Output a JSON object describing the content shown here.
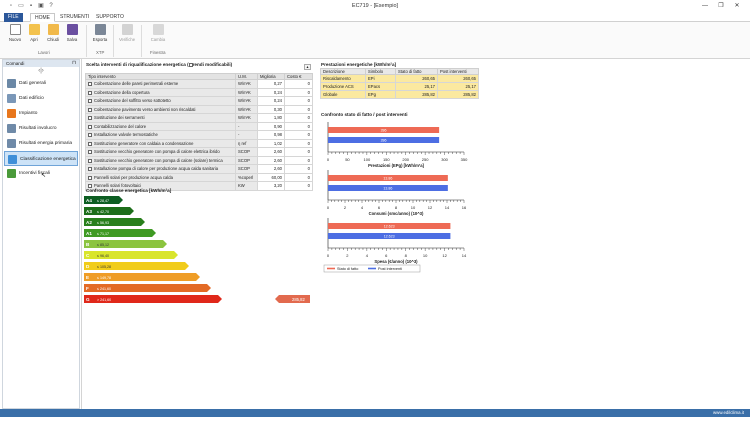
{
  "window": {
    "title": "EC719 - [Esempio]",
    "min": "—",
    "max": "❐",
    "close": "✕"
  },
  "menu": {
    "file": "FILE",
    "home": "HOME",
    "tools": "STRUMENTI",
    "support": "SUPPORTO"
  },
  "ribbon": {
    "new": "Nuovo",
    "open": "Apri",
    "close": "Chiudi",
    "save": "Salva",
    "export": "Esporta",
    "verify": "Verifiche",
    "change": "Cambia",
    "group_work": "Lavori",
    "group_xtp": "XTP",
    "group_window": "Finestra"
  },
  "sidebar": {
    "header": "Comandi",
    "items": [
      {
        "label": "Dati generali",
        "icon": "general-data-icon",
        "color": "#6b88a6"
      },
      {
        "label": "Dati edificio",
        "icon": "building-data-icon",
        "color": "#7a97b8"
      },
      {
        "label": "Impianto",
        "icon": "flame-icon",
        "color": "#e8761c"
      },
      {
        "label": "Risultati involucro",
        "icon": "grid-icon",
        "color": "#6f8aa8"
      },
      {
        "label": "Risultati energia primaria",
        "icon": "grid-icon",
        "color": "#6f8aa8"
      },
      {
        "label": "Classificazione energetica",
        "icon": "energy-class-icon",
        "color": "#3f8fd8"
      },
      {
        "label": "Incentivi fiscali",
        "icon": "leaf-icon",
        "color": "#4a9a3a"
      }
    ]
  },
  "interventions": {
    "title": "Scelta interventi di riqualificazione energetica (",
    "title_suffix": "rendi modificabili)",
    "headers": [
      "Tipo intervento",
      "U.M.",
      "Miglioria",
      "Costo €"
    ],
    "rows": [
      [
        "Coibentazione delle pareti perimetrali esterne",
        "W/m²K",
        "0,27",
        "0"
      ],
      [
        "Coibentazione della copertura",
        "W/m²K",
        "0,24",
        "0"
      ],
      [
        "Coibentazione del soffitto verso sottotetto",
        "W/m²K",
        "0,24",
        "0"
      ],
      [
        "Coibentazione pavimento verso ambienti non riscaldati",
        "W/m²K",
        "0,30",
        "0"
      ],
      [
        "Sostituzione dei serramenti",
        "W/m²K",
        "1,80",
        "0"
      ],
      [
        "Contabilizzazione del calore",
        "-",
        "0,90",
        "0"
      ],
      [
        "Installazione valvole termostatiche",
        "-",
        "0,98",
        "0"
      ],
      [
        "Sostituzione generatore con caldaia a condensazione",
        "η ref",
        "1,02",
        "0"
      ],
      [
        "Sostituzione vecchio generatore con pompa di calore elettrica ibrido",
        "SCOP",
        "2,60",
        "0"
      ],
      [
        "Sostituzione vecchio generatore con pompa di calore (solare) termica",
        "SCOP",
        "2,60",
        "0"
      ],
      [
        "Installazione pompa di calore per produzione acqua calda sanitaria",
        "SCOP",
        "2,60",
        "0"
      ],
      [
        "Pannelli solari per produzione acqua calda",
        "%coperl",
        "60,00",
        "0"
      ],
      [
        "Pannelli solari fotovoltaici",
        "KW",
        "3,20",
        "0"
      ]
    ]
  },
  "classes": {
    "title": "Confronto classe energetica [kWh/m²a]",
    "list": [
      {
        "label": "A4",
        "value": "≤ 28,47",
        "color": "#0d5e22"
      },
      {
        "label": "A3",
        "value": "≤ 42,70",
        "color": "#1d6e1a"
      },
      {
        "label": "A2",
        "value": "≤ 56,93",
        "color": "#297f1c"
      },
      {
        "label": "A1",
        "value": "≤ 71,17",
        "color": "#3f9a23"
      },
      {
        "label": "B",
        "value": "≤ 85,12",
        "color": "#8bc43f"
      },
      {
        "label": "C",
        "value": "≤ 96,40",
        "color": "#d9e52c"
      },
      {
        "label": "D",
        "value": "≤ 105,28",
        "color": "#f1cc1a"
      },
      {
        "label": "E",
        "value": "≤ 149,78",
        "color": "#ef9d26"
      },
      {
        "label": "F",
        "value": "≤ 241,60",
        "color": "#e36a25"
      },
      {
        "label": "G",
        "value": "> 241,60",
        "color": "#e0281a"
      }
    ],
    "marker_value": "285,82",
    "marker_color": "#e26a4e"
  },
  "performance": {
    "title": "Prestazioni energetiche [kWh/m²a]",
    "headers": [
      "Descrizione",
      "Simbolo",
      "Stato di fatto",
      "Post interventi"
    ],
    "rows": [
      [
        "Riscaldamento",
        "EPi",
        "260,65",
        "260,65"
      ],
      [
        "Produzione ACS",
        "EPacs",
        "25,17",
        "25,17"
      ],
      [
        "Globale",
        "EPg",
        "285,82",
        "285,82"
      ]
    ]
  },
  "compare_title": "Confronto stato di fatto / post interventi",
  "chart_data": {
    "type": "bar",
    "charts": [
      {
        "title": "Prestazioni (EPg) [kWh/m²a]",
        "xlim": [
          0,
          350
        ],
        "ticks": [
          0,
          50,
          100,
          150,
          200,
          250,
          300,
          350
        ],
        "values": [
          286,
          286
        ],
        "labels": [
          "286",
          "286"
        ]
      },
      {
        "title": "Consumi (smc/anno) (10^3)",
        "xlim": [
          0,
          16
        ],
        "ticks": [
          0,
          2,
          4,
          6,
          8,
          10,
          12,
          14,
          16
        ],
        "values": [
          14.1,
          14.1
        ],
        "labels": [
          "13.86",
          "13.86"
        ]
      },
      {
        "title": "Spesa (€/anno) (10^3)",
        "xlim": [
          0,
          14
        ],
        "ticks": [
          0,
          2,
          4,
          6,
          8,
          10,
          12,
          14
        ],
        "values": [
          12.6,
          12.6
        ],
        "labels": [
          "12.623",
          "12.623"
        ]
      }
    ],
    "legend": [
      "Stato di fatto",
      "Post interventi"
    ],
    "colors": [
      "#ee6a55",
      "#4d6ee3"
    ]
  },
  "status": {
    "url": "www.edilclima.it"
  }
}
